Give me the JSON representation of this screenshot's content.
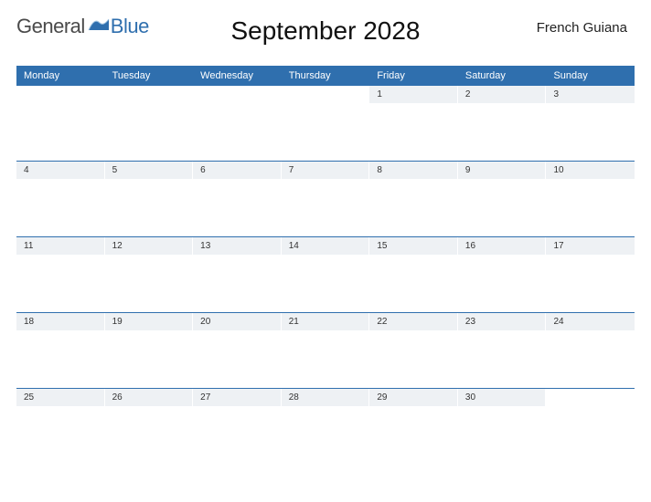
{
  "logo": {
    "part1": "General",
    "part2": "Blue"
  },
  "title": "September 2028",
  "region": "French Guiana",
  "daynames": [
    "Monday",
    "Tuesday",
    "Wednesday",
    "Thursday",
    "Friday",
    "Saturday",
    "Sunday"
  ],
  "weeks": [
    [
      "",
      "",
      "",
      "",
      "1",
      "2",
      "3"
    ],
    [
      "4",
      "5",
      "6",
      "7",
      "8",
      "9",
      "10"
    ],
    [
      "11",
      "12",
      "13",
      "14",
      "15",
      "16",
      "17"
    ],
    [
      "18",
      "19",
      "20",
      "21",
      "22",
      "23",
      "24"
    ],
    [
      "25",
      "26",
      "27",
      "28",
      "29",
      "30",
      ""
    ]
  ]
}
